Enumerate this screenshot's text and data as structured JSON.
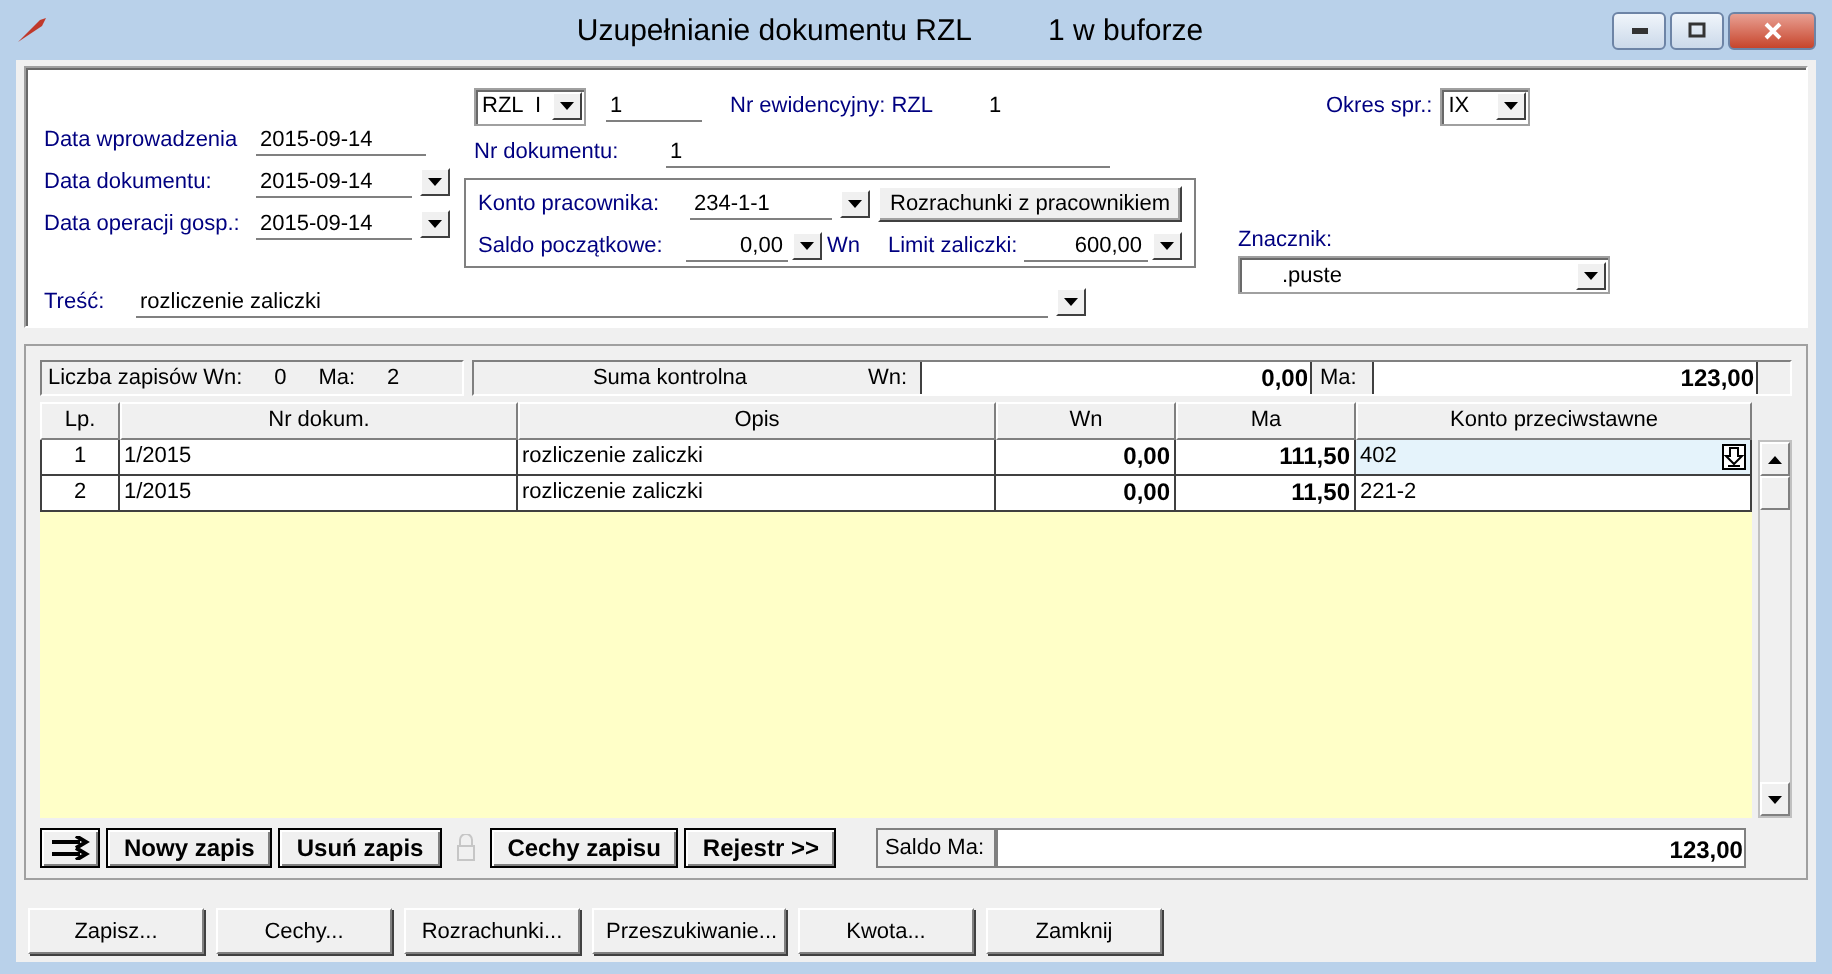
{
  "window": {
    "title": "Uzupełnianie dokumentu RZL",
    "buffer": "1 w buforze"
  },
  "dates": [
    {
      "label": "Data wprowadzenia",
      "value": "2015-09-14",
      "kind": "text"
    },
    {
      "label": "Data dokumentu:",
      "value": "2015-09-14",
      "kind": "dropdown"
    },
    {
      "label": "Data operacji gosp.:",
      "value": "2015-09-14",
      "kind": "dropdown"
    }
  ],
  "document": {
    "type": "RZL  I",
    "number": "1",
    "register_label": "Nr ewidencyjny: RZL",
    "register_number": "1",
    "doc_label": "Nr dokumentu:",
    "doc_value": "1"
  },
  "employee": {
    "account_label": "Konto pracownika:",
    "account": "234-1-1",
    "button": "Rozrachunki z pracownikiem",
    "balance_label": "Saldo początkowe:",
    "balance": "0,00",
    "balance_side": "Wn",
    "limit_label": "Limit zaliczki:",
    "limit": "600,00"
  },
  "content": {
    "label": "Treść:",
    "value": "rozliczenie zaliczki"
  },
  "period": {
    "label": "Okres spr.:",
    "value": "IX"
  },
  "marker": {
    "label": "Znacznik:",
    "value": ".puste"
  },
  "summary": {
    "count_label": "Liczba zapisów Wn:",
    "count_wn": "0",
    "count_ma_label": "Ma:",
    "count_ma": "2",
    "checksum_label": "Suma kontrolna",
    "wn_label": "Wn:",
    "wn_value": "0,00",
    "ma_label": "Ma:",
    "ma_value": "123,00"
  },
  "table": {
    "columns": [
      "Lp.",
      "Nr dokum.",
      "Opis",
      "Wn",
      "Ma",
      "Konto przeciwstawne"
    ],
    "rows": [
      {
        "lp": "1",
        "doc": "1/2015",
        "description": "rozliczenie zaliczki",
        "wn": "0,00",
        "ma": "111,50",
        "account": "402",
        "selected": true
      },
      {
        "lp": "2",
        "doc": "1/2015",
        "description": "rozliczenie zaliczki",
        "wn": "0,00",
        "ma": "11,50",
        "account": "221-2",
        "selected": false
      }
    ]
  },
  "toolbar": {
    "buttons": [
      {
        "kind": "icon",
        "disabled": false
      },
      {
        "kind": "text",
        "label": "Nowy zapis",
        "disabled": false
      },
      {
        "kind": "text",
        "label": "Usuń zapis",
        "disabled": false
      },
      {
        "kind": "lock",
        "disabled": true
      },
      {
        "kind": "text",
        "label": "Cechy zapisu",
        "disabled": false
      },
      {
        "kind": "text",
        "label": "Rejestr >>",
        "disabled": false
      }
    ],
    "balance_label": "Saldo Ma:",
    "balance_value": "123,00"
  },
  "footer_buttons": [
    "Zapisz...",
    "Cechy...",
    "Rozrachunki...",
    "Przeszukiwanie...",
    "Kwota...",
    "Zamknij"
  ]
}
